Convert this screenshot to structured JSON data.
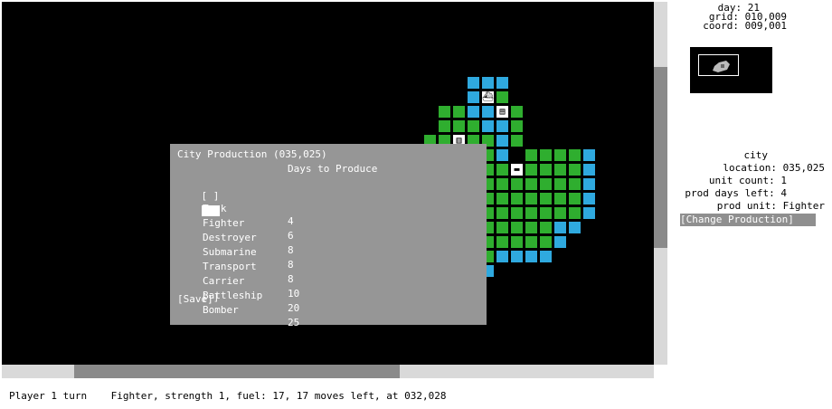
{
  "map": {
    "colors": {
      "land": "#2fae2f",
      "water": "#2fa9df",
      "background": "#000000"
    },
    "units": [
      {
        "name": "transport-ship-icon"
      },
      {
        "name": "city-icon"
      },
      {
        "name": "factory-icon"
      },
      {
        "name": "tank-icon"
      }
    ]
  },
  "stats": {
    "day_label": "day: 21",
    "grid_label": "grid: 010,009",
    "coord_label": "coord: 009,001"
  },
  "info": {
    "type": "city",
    "location": "location: 035,025",
    "unit_count": "unit count: 1",
    "prod_days_left": "prod days left: 4",
    "prod_unit": "prod unit: Fighter",
    "change_button": "[Change Production]"
  },
  "dialog": {
    "title": "City Production (035,025)",
    "header": "Days to Produce",
    "items": [
      {
        "checkbox": "[ ]",
        "name": "Tank",
        "days": "4"
      },
      {
        "checkbox": "",
        "name": "Fighter",
        "days": "6",
        "selected": true
      },
      {
        "checkbox": "",
        "name": "Destroyer",
        "days": "8"
      },
      {
        "checkbox": "",
        "name": "Submarine",
        "days": "8"
      },
      {
        "checkbox": "",
        "name": "Transport",
        "days": "8"
      },
      {
        "checkbox": "",
        "name": "Carrier",
        "days": "10"
      },
      {
        "checkbox": "",
        "name": "Battleship",
        "days": "20"
      },
      {
        "checkbox": "[ ]",
        "name": "Bomber",
        "days": "25"
      }
    ],
    "save": "[Save]"
  },
  "status": {
    "turn": "Player 1 turn",
    "unit_info": "Fighter, strength 1, fuel: 17, 17 moves left, at 032,028"
  }
}
